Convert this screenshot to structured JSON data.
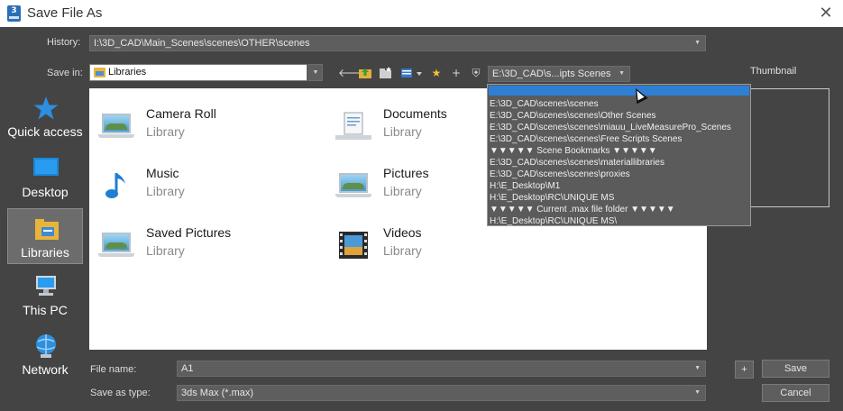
{
  "window": {
    "title": "Save File As",
    "app_icon_text": "3",
    "close_glyph": "✕"
  },
  "history": {
    "label": "History:",
    "value": "I:\\3D_CAD\\Main_Scenes\\scenes\\OTHER\\scenes"
  },
  "save_in": {
    "label": "Save in:",
    "value": "Libraries"
  },
  "toolbar": {
    "recent_folder_value": "E:\\3D_CAD\\s...ipts Scenes",
    "icons": [
      "back-icon",
      "up-folder-icon",
      "new-folder-icon",
      "view-menu-icon",
      "favorite-star-icon",
      "add-icon",
      "shield-icon"
    ]
  },
  "thumbnail": {
    "label": "Thumbnail"
  },
  "places": [
    {
      "label": "Quick access",
      "icon": "star-icon"
    },
    {
      "label": "Desktop",
      "icon": "desktop-icon"
    },
    {
      "label": "Libraries",
      "icon": "libraries-icon",
      "selected": true
    },
    {
      "label": "This PC",
      "icon": "computer-icon"
    },
    {
      "label": "Network",
      "icon": "network-icon"
    }
  ],
  "files": [
    {
      "name": "Camera Roll",
      "type": "Library",
      "icon": "camera-roll-icon"
    },
    {
      "name": "Documents",
      "type": "Library",
      "icon": "documents-icon"
    },
    {
      "name": "Music",
      "type": "Library",
      "icon": "music-icon"
    },
    {
      "name": "Pictures",
      "type": "Library",
      "icon": "pictures-icon"
    },
    {
      "name": "Saved Pictures",
      "type": "Library",
      "icon": "saved-pictures-icon"
    },
    {
      "name": "Videos",
      "type": "Library",
      "icon": "videos-icon"
    }
  ],
  "dropdown": {
    "items": [
      "",
      "E:\\3D_CAD\\scenes\\scenes",
      "E:\\3D_CAD\\scenes\\scenes\\Other Scenes",
      "E:\\3D_CAD\\scenes\\scenes\\miauu_LiveMeasurePro_Scenes",
      "E:\\3D_CAD\\scenes\\scenes\\Free Scripts Scenes",
      "▼▼▼▼▼ Scene Bookmarks ▼▼▼▼▼",
      "E:\\3D_CAD\\scenes\\scenes\\materiallibraries",
      "E:\\3D_CAD\\scenes\\scenes\\proxies",
      "H:\\E_Desktop\\M1",
      "H:\\E_Desktop\\RC\\UNIQUE MS",
      "▼▼▼▼▼ Current .max file folder ▼▼▼▼▼",
      "H:\\E_Desktop\\RC\\UNIQUE MS\\"
    ]
  },
  "filename": {
    "label": "File name:",
    "value": "A1"
  },
  "save_as_type": {
    "label": "Save as type:",
    "value": "3ds Max (*.max)"
  },
  "buttons": {
    "plus": "+",
    "save": "Save",
    "cancel": "Cancel"
  }
}
